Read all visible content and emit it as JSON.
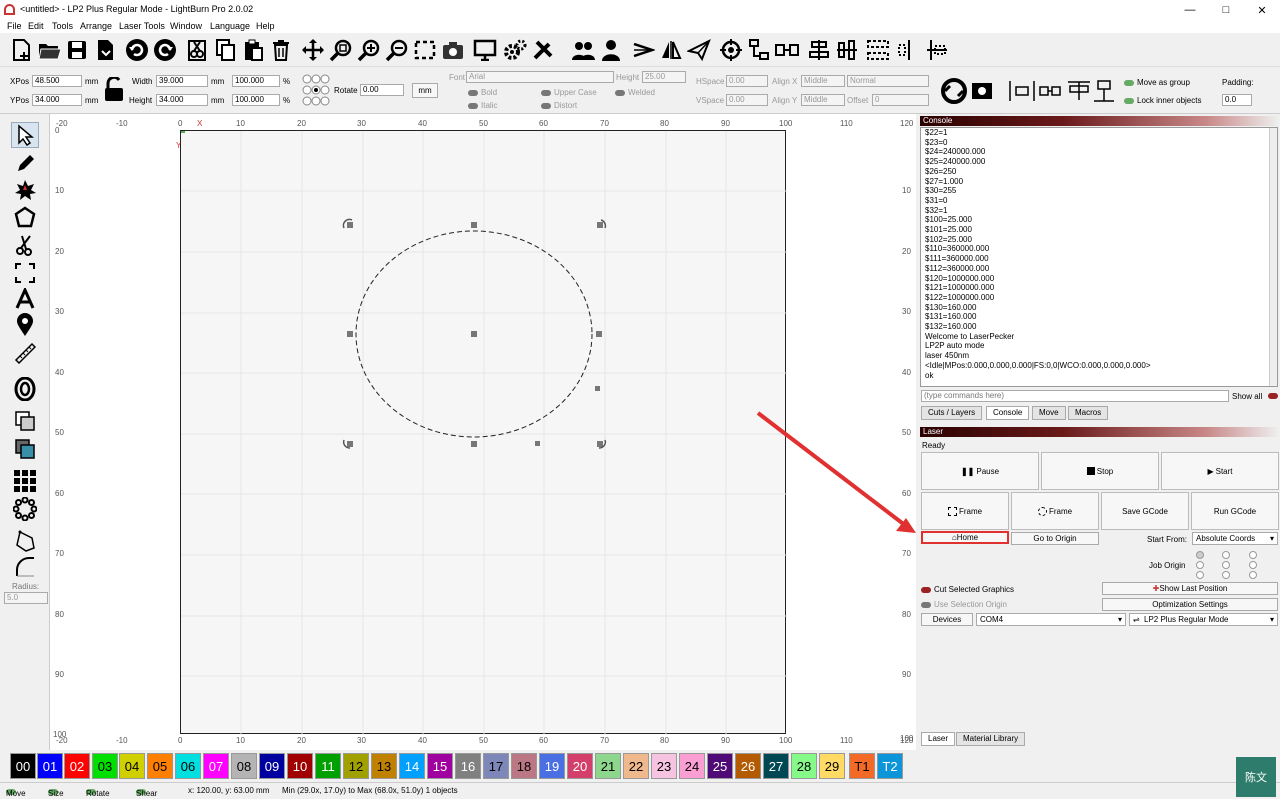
{
  "window": {
    "title": "<untitled> - LP2 Plus Regular Mode - LightBurn Pro 2.0.02"
  },
  "menu": [
    "File",
    "Edit",
    "Tools",
    "Arrange",
    "Laser Tools",
    "Window",
    "Language",
    "Help"
  ],
  "props": {
    "xpos_label": "XPos",
    "xpos": "48.500",
    "ypos_label": "YPos",
    "ypos": "34.000",
    "unit_mm": "mm",
    "width_label": "Width",
    "width": "39.000",
    "height_label": "Height",
    "height": "34.000",
    "scale_w": "100.000",
    "scale_h": "100.000",
    "pct": "%",
    "rotate_label": "Rotate",
    "rotate": "0.00",
    "mm_btn": "mm",
    "font_label": "Font",
    "font": "Arial",
    "fheight_label": "Height",
    "fheight": "25.00",
    "bold": "Bold",
    "italic": "Italic",
    "upper": "Upper Case",
    "distort": "Distort",
    "welded": "Welded",
    "hspace_label": "HSpace",
    "hspace": "0.00",
    "vspace_label": "VSpace",
    "vspace": "0.00",
    "alignx_label": "Align X",
    "alignx": "Middle",
    "aligny_label": "Align Y",
    "aligny": "Middle",
    "normal": "Normal",
    "offset_label": "Offset",
    "offset": "0",
    "move_group": "Move as group",
    "lock_inner": "Lock inner objects",
    "padding_label": "Padding:",
    "padding": "0.0"
  },
  "left": {
    "radius_label": "Radius:",
    "radius": "5.0"
  },
  "ruler": {
    "x": [
      "-20",
      "-10",
      "0",
      "10",
      "20",
      "30",
      "40",
      "50",
      "60",
      "70",
      "80",
      "90",
      "100",
      "110",
      "120"
    ],
    "y": [
      "0",
      "10",
      "20",
      "30",
      "40",
      "50",
      "60",
      "70",
      "80",
      "90",
      "100"
    ],
    "x_axis": "X",
    "y_axis": "Y"
  },
  "console": {
    "header": "Console",
    "lines": [
      "$22=1",
      "$23=0",
      "$24=240000.000",
      "$25=240000.000",
      "$26=250",
      "$27=1.000",
      "$30=255",
      "$31=0",
      "$32=1",
      "$100=25.000",
      "$101=25.000",
      "$102=25.000",
      "$110=360000.000",
      "$111=360000.000",
      "$112=360000.000",
      "$120=1000000.000",
      "$121=1000000.000",
      "$122=1000000.000",
      "$130=160.000",
      "$131=160.000",
      "$132=160.000",
      "Welcome to LaserPecker",
      "LP2P auto mode",
      "laser 450nm",
      "<Idle|MPos:0.000,0.000,0.000|FS:0,0|WCO:0.000,0.000,0.000>",
      "ok"
    ],
    "cmd_placeholder": "(type commands here)",
    "show_all": "Show all",
    "tabs": [
      "Cuts / Layers",
      "Console",
      "Move",
      "Macros"
    ]
  },
  "laser": {
    "header": "Laser",
    "status": "Ready",
    "pause": "Pause",
    "stop": "Stop",
    "start": "Start",
    "frame1": "Frame",
    "frame2": "Frame",
    "save_gcode": "Save GCode",
    "run_gcode": "Run GCode",
    "home": "Home",
    "go_origin": "Go to Origin",
    "start_from_label": "Start From:",
    "start_from": "Absolute Coords",
    "job_origin_label": "Job Origin",
    "cut_selected": "Cut Selected Graphics",
    "use_sel_origin": "Use Selection Origin",
    "show_last": "Show Last Position",
    "opt_settings": "Optimization Settings",
    "devices": "Devices",
    "port": "COM4",
    "device": "LP2 Plus Regular Mode",
    "bottom_tabs": [
      "Laser",
      "Material Library"
    ]
  },
  "palette": [
    {
      "t": "00",
      "c": "#000000",
      "f": "#ffffff"
    },
    {
      "t": "01",
      "c": "#0000ff",
      "f": "#ffffff"
    },
    {
      "t": "02",
      "c": "#ff0000",
      "f": "#ffffff"
    },
    {
      "t": "03",
      "c": "#00e000",
      "f": "#000000"
    },
    {
      "t": "04",
      "c": "#d0d000",
      "f": "#000000"
    },
    {
      "t": "05",
      "c": "#ff8000",
      "f": "#000000"
    },
    {
      "t": "06",
      "c": "#00e0e0",
      "f": "#000000"
    },
    {
      "t": "07",
      "c": "#ff00ff",
      "f": "#ffffff"
    },
    {
      "t": "08",
      "c": "#b4b4b4",
      "f": "#000000"
    },
    {
      "t": "09",
      "c": "#0000a0",
      "f": "#ffffff"
    },
    {
      "t": "10",
      "c": "#a00000",
      "f": "#ffffff"
    },
    {
      "t": "11",
      "c": "#00a000",
      "f": "#ffffff"
    },
    {
      "t": "12",
      "c": "#a0a000",
      "f": "#000000"
    },
    {
      "t": "13",
      "c": "#c08000",
      "f": "#000000"
    },
    {
      "t": "14",
      "c": "#00a0ff",
      "f": "#ffffff"
    },
    {
      "t": "15",
      "c": "#a000a0",
      "f": "#ffffff"
    },
    {
      "t": "16",
      "c": "#808080",
      "f": "#ffffff"
    },
    {
      "t": "17",
      "c": "#7d87b9",
      "f": "#000000"
    },
    {
      "t": "18",
      "c": "#bb7784",
      "f": "#000000"
    },
    {
      "t": "19",
      "c": "#4a6fe3",
      "f": "#ffffff"
    },
    {
      "t": "20",
      "c": "#d33f6a",
      "f": "#ffffff"
    },
    {
      "t": "21",
      "c": "#8cd78c",
      "f": "#000000"
    },
    {
      "t": "22",
      "c": "#f0b98d",
      "f": "#000000"
    },
    {
      "t": "23",
      "c": "#f6c4e1",
      "f": "#000000"
    },
    {
      "t": "24",
      "c": "#fa9ed4",
      "f": "#000000"
    },
    {
      "t": "25",
      "c": "#500a78",
      "f": "#ffffff"
    },
    {
      "t": "26",
      "c": "#b45a00",
      "f": "#ffffff"
    },
    {
      "t": "27",
      "c": "#004754",
      "f": "#ffffff"
    },
    {
      "t": "28",
      "c": "#86fa88",
      "f": "#000000"
    },
    {
      "t": "29",
      "c": "#ffdb66",
      "f": "#000000"
    },
    {
      "t": "T1",
      "c": "#f36926",
      "f": "#000000"
    },
    {
      "t": "T2",
      "c": "#0c96d9",
      "f": "#ffffff"
    }
  ],
  "status": {
    "move": "Move",
    "size": "Size",
    "rotate": "Rotate",
    "shear": "Shear",
    "coords": "x: 120.00, y: 63.00 mm",
    "range": "Min (29.0x, 17.0y) to Max (68.0x, 51.0y)  1 objects"
  },
  "user_badge": "陈文"
}
